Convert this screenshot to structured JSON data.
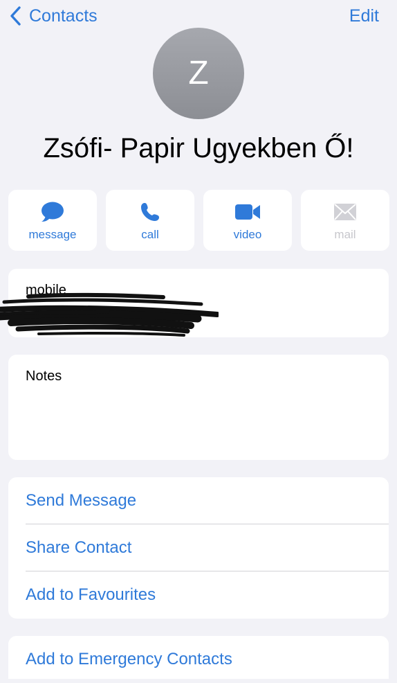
{
  "nav": {
    "back_label": "Contacts",
    "edit_label": "Edit"
  },
  "avatar": {
    "initial": "Z"
  },
  "contact": {
    "name": "Zsófi- Papir Ugyekben Ő!"
  },
  "actions": [
    {
      "label": "message",
      "icon": "message-bubble-icon",
      "enabled": true
    },
    {
      "label": "call",
      "icon": "phone-icon",
      "enabled": true
    },
    {
      "label": "video",
      "icon": "video-camera-icon",
      "enabled": true
    },
    {
      "label": "mail",
      "icon": "envelope-icon",
      "enabled": false
    }
  ],
  "phone": {
    "label": "mobile"
  },
  "notes": {
    "label": "Notes"
  },
  "list": {
    "send_message": "Send Message",
    "share_contact": "Share Contact",
    "add_favourites": "Add to Favourites",
    "emergency": "Add to Emergency Contacts"
  },
  "colors": {
    "accent": "#2f7ad9",
    "background": "#f2f2f7",
    "card": "#ffffff",
    "disabled": "#c7c7cc"
  }
}
